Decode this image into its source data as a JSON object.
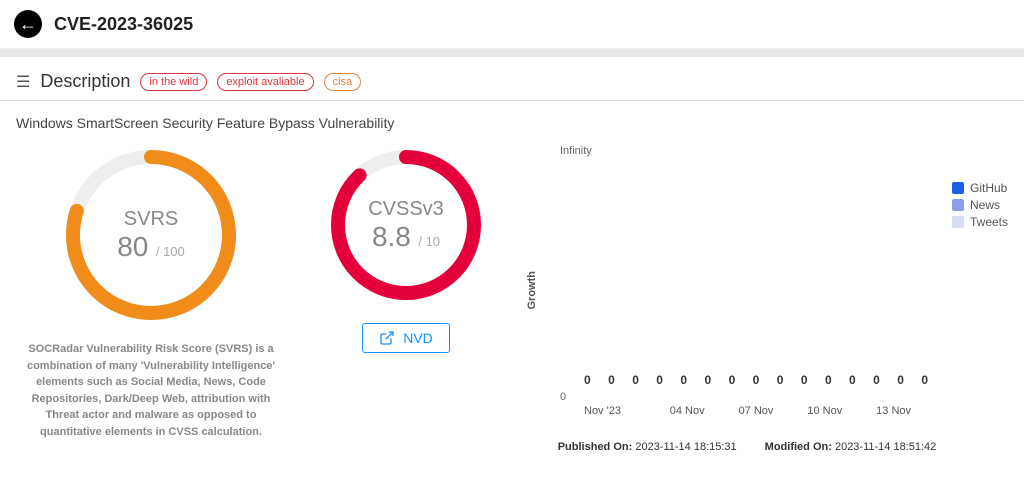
{
  "header": {
    "cve_id": "CVE-2023-36025"
  },
  "section": {
    "title": "Description"
  },
  "badges": {
    "wild": "in the wild",
    "exploit": "exploit avaliable",
    "cisa": "cisa"
  },
  "vuln_title": "Windows SmartScreen Security Feature Bypass Vulnerability",
  "svrs": {
    "label": "SVRS",
    "value": "80",
    "max": "/ 100",
    "desc": "SOCRadar Vulnerability Risk Score (SVRS) is a combination of many 'Vulnerability Intelligence' elements such as Social Media, News, Code Repositories, Dark/Deep Web, attribution with Threat actor and malware as opposed to quantitative elements in CVSS calculation.",
    "color": "#f08c1a"
  },
  "cvss": {
    "label": "CVSSv3",
    "value": "8.8",
    "max": "/ 10",
    "nvd_label": "NVD",
    "color": "#e4003a"
  },
  "chart_data": {
    "type": "bar",
    "title": "",
    "ylabel": "Growth",
    "yticks": [
      "Infinity",
      "0"
    ],
    "x_labels": [
      "Nov '23",
      "04 Nov",
      "07 Nov",
      "10 Nov",
      "13 Nov"
    ],
    "series": [
      {
        "name": "GitHub",
        "color": "#1b5fe3",
        "values": [
          0,
          0,
          0,
          0,
          0,
          0,
          0,
          0,
          0,
          0,
          0,
          0,
          0,
          0,
          0
        ]
      },
      {
        "name": "News",
        "color": "#8aa0e6",
        "values": [
          0,
          0,
          0,
          0,
          0,
          0,
          0,
          0,
          0,
          0,
          0,
          0,
          0,
          0,
          0
        ]
      },
      {
        "name": "Tweets",
        "color": "#d6ddf4",
        "values": [
          0,
          0,
          0,
          0,
          0,
          0,
          0,
          0,
          0,
          0,
          0,
          0,
          0,
          0,
          0
        ]
      }
    ]
  },
  "meta": {
    "published_label": "Published On:",
    "published_value": "2023-11-14 18:15:31",
    "modified_label": "Modified On:",
    "modified_value": "2023-11-14 18:51:42"
  }
}
